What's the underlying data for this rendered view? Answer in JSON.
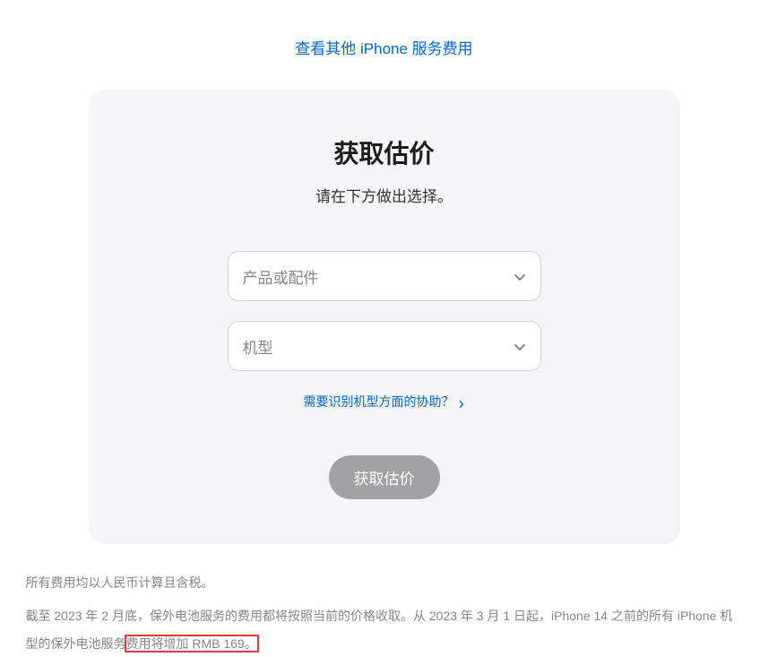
{
  "topLink": {
    "text": "查看其他 iPhone 服务费用"
  },
  "card": {
    "title": "获取估价",
    "subtitle": "请在下方做出选择。",
    "select1": {
      "placeholder": "产品或配件"
    },
    "select2": {
      "placeholder": "机型"
    },
    "helpLink": {
      "text": "需要识别机型方面的协助？"
    },
    "button": {
      "label": "获取估价"
    }
  },
  "footer": {
    "line1": "所有费用均以人民币计算且含税。",
    "line2_part1": "截至 2023 年 2 月底，保外电池服务的费用都将按照当前的价格收取。从 2023 年 3 月 1 日起，iPhone 14 之前的所有 iPhone 机型的保外电池服务",
    "line2_highlight": "费用将增加 RMB 169。"
  }
}
